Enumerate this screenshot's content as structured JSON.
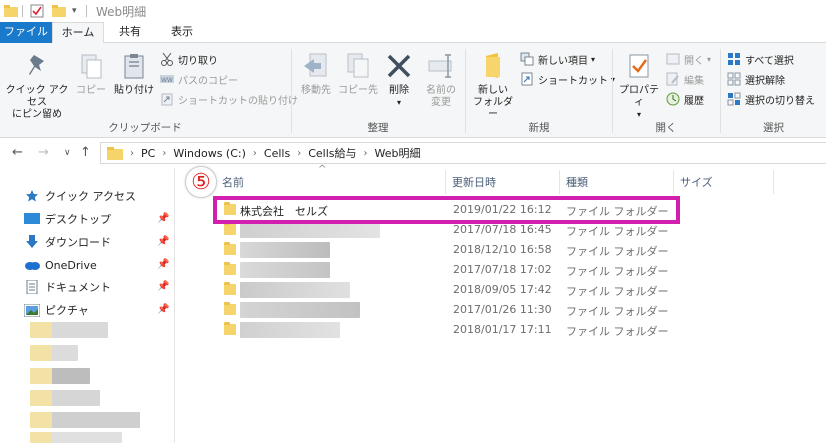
{
  "window": {
    "title": "Web明細"
  },
  "ribbon_tabs": [
    "ファイル",
    "ホーム",
    "共有",
    "表示"
  ],
  "ribbon": {
    "clipboard": {
      "pin_quick_access": "クイック アクセス\nにピン留め",
      "copy": "コピー",
      "paste": "貼り付け",
      "cut": "切り取り",
      "copy_path": "パスのコピー",
      "paste_shortcut": "ショートカットの貼り付け",
      "label": "クリップボード"
    },
    "organize": {
      "move_to": "移動先",
      "copy_to": "コピー先",
      "delete": "削除",
      "rename": "名前の\n変更",
      "label": "整理"
    },
    "new": {
      "new_folder": "新しい\nフォルダー",
      "new_item": "新しい項目",
      "shortcut": "ショートカット",
      "label": "新規"
    },
    "open": {
      "properties": "プロパティ",
      "open": "開く",
      "edit": "編集",
      "history": "履歴",
      "label": "開く"
    },
    "select": {
      "select_all": "すべて選択",
      "select_none": "選択解除",
      "invert": "選択の切り替え",
      "label": "選択"
    }
  },
  "address": {
    "crumbs": [
      "PC",
      "Windows (C:)",
      "Cells",
      "Cells給与",
      "Web明細"
    ]
  },
  "navpane": {
    "items": [
      {
        "label": "クイック アクセス",
        "icon": "star-icon",
        "pinned": false
      },
      {
        "label": "デスクトップ",
        "icon": "desktop-icon",
        "pinned": true
      },
      {
        "label": "ダウンロード",
        "icon": "download-icon",
        "pinned": true
      },
      {
        "label": "OneDrive",
        "icon": "cloud-icon",
        "pinned": true
      },
      {
        "label": "ドキュメント",
        "icon": "document-icon",
        "pinned": true
      },
      {
        "label": "ピクチャ",
        "icon": "picture-icon",
        "pinned": true
      }
    ]
  },
  "columns": {
    "name": "名前",
    "date": "更新日時",
    "type": "種類",
    "size": "サイズ"
  },
  "files": [
    {
      "name": "株式会社　セルズ",
      "date": "2019/01/22 16:12",
      "type": "ファイル フォルダー"
    },
    {
      "name": "",
      "date": "2017/07/18 16:45",
      "type": "ファイル フォルダー"
    },
    {
      "name": "",
      "date": "2018/12/10 16:58",
      "type": "ファイル フォルダー"
    },
    {
      "name": "",
      "date": "2017/07/18 17:02",
      "type": "ファイル フォルダー"
    },
    {
      "name": "",
      "date": "2018/09/05 17:42",
      "type": "ファイル フォルダー"
    },
    {
      "name": "",
      "date": "2017/01/26 11:30",
      "type": "ファイル フォルダー"
    },
    {
      "name": "",
      "date": "2018/01/17 17:11",
      "type": "ファイル フォルダー"
    }
  ],
  "annotation": {
    "step": "⑤"
  },
  "colors": {
    "accent": "#1979ca",
    "highlight": "#d21fb0",
    "step": "#e0201c"
  }
}
